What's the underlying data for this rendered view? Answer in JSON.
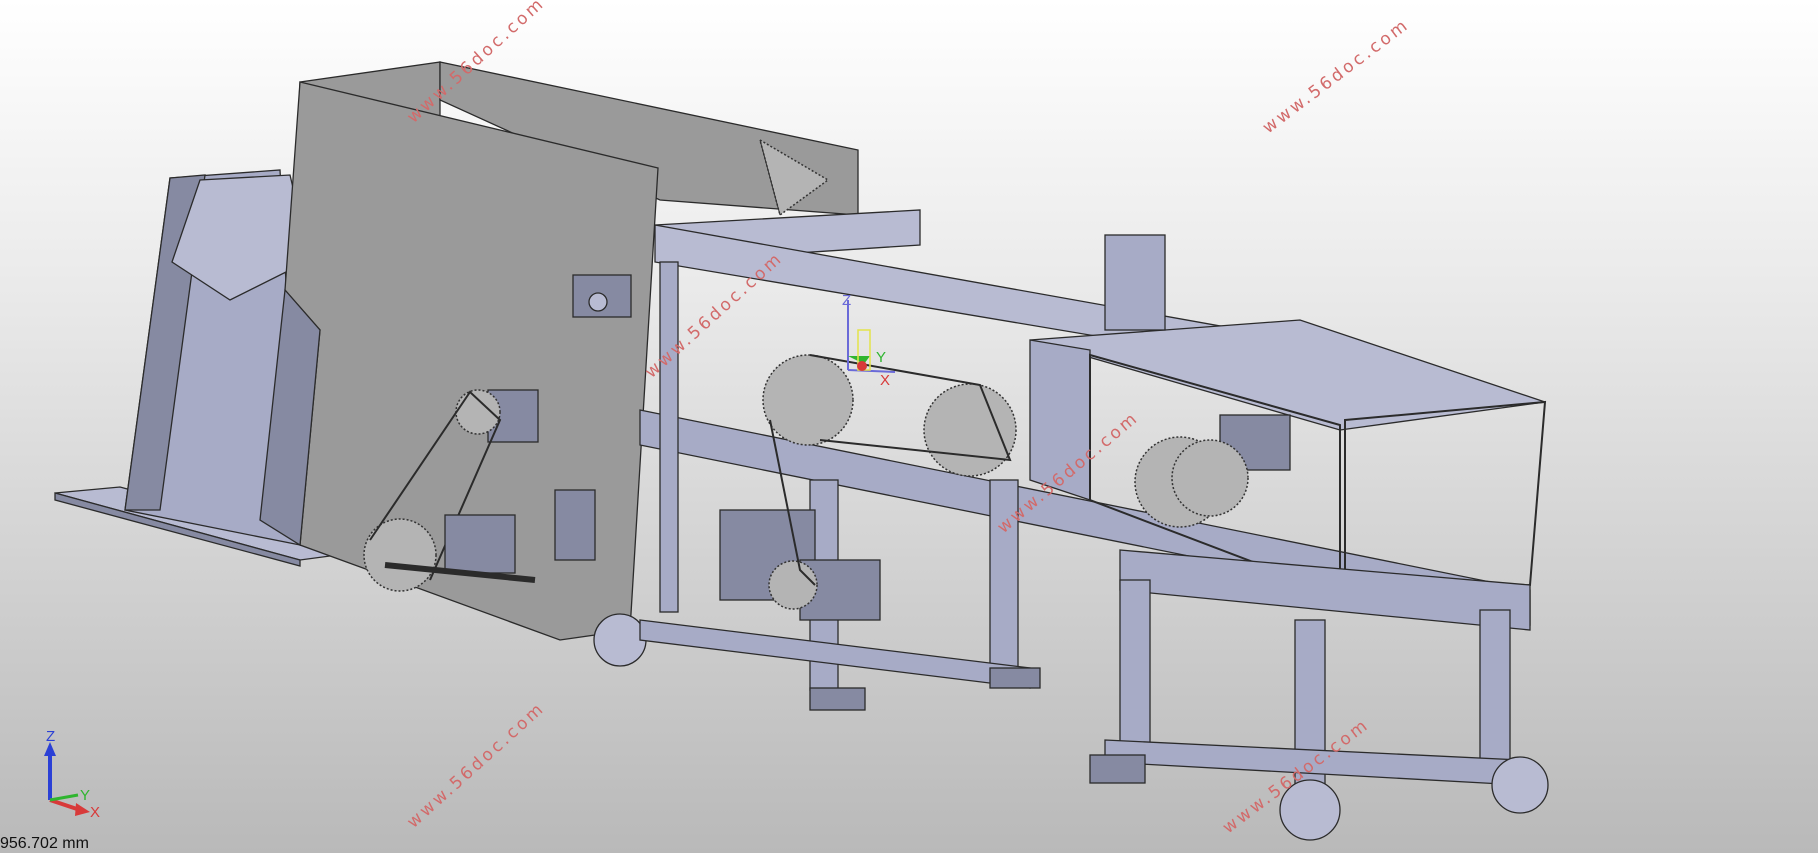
{
  "viewport": {
    "scale_readout": "956.702 mm",
    "background_top": "#ffffff",
    "background_bottom": "#b9b9b9",
    "model_color": "#a7abc6",
    "model_dark": "#7f8297",
    "edge_color": "#2b2b2b"
  },
  "triad": {
    "z": "Z",
    "y": "Y",
    "x": "X"
  },
  "origin_marker": {
    "z": "Z",
    "y": "Y",
    "x": "X"
  },
  "watermark": {
    "text": "www.56doc.com",
    "color": "#d26a6a"
  }
}
